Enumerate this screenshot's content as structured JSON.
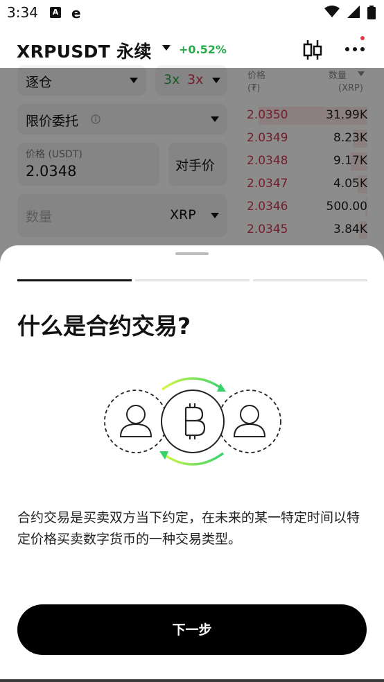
{
  "status": {
    "time": "3:34",
    "icon_a": "A"
  },
  "header": {
    "pair": "XRPUSDT 永续",
    "change": "+0.52%"
  },
  "form": {
    "margin_mode": "逐仓",
    "leverage_long": "3x",
    "leverage_short": "3x",
    "order_type": "限价委托",
    "price_label": "价格 (USDT)",
    "price_value": "2.0348",
    "counterparty_label": "对手价",
    "qty_placeholder": "数量",
    "qty_unit": "XRP"
  },
  "orderbook": {
    "col_price": "价格",
    "col_price_unit": "(₮)",
    "col_qty": "数量",
    "col_qty_unit": "(XRP)",
    "asks": [
      {
        "price": "2.0350",
        "qty": "31.99K",
        "depth": 0.9
      },
      {
        "price": "2.0349",
        "qty": "8.23K",
        "depth": 0.12
      },
      {
        "price": "2.0348",
        "qty": "9.17K",
        "depth": 0.14
      },
      {
        "price": "2.0347",
        "qty": "4.05K",
        "depth": 0.08
      },
      {
        "price": "2.0346",
        "qty": "500.00",
        "depth": 0.02
      },
      {
        "price": "2.0345",
        "qty": "3.84K",
        "depth": 0.07
      }
    ]
  },
  "sheet": {
    "title": "什么是合约交易?",
    "description": "合约交易是买卖双方当下约定，在未来的某一特定时间以特定价格买卖数字货币的一种交易类型。",
    "next_label": "下一步",
    "steps_total": 3,
    "step_current": 1
  },
  "colors": {
    "ask": "#d23a50",
    "bid": "#27a84a",
    "accent": "#7be04a",
    "button": "#000000"
  }
}
